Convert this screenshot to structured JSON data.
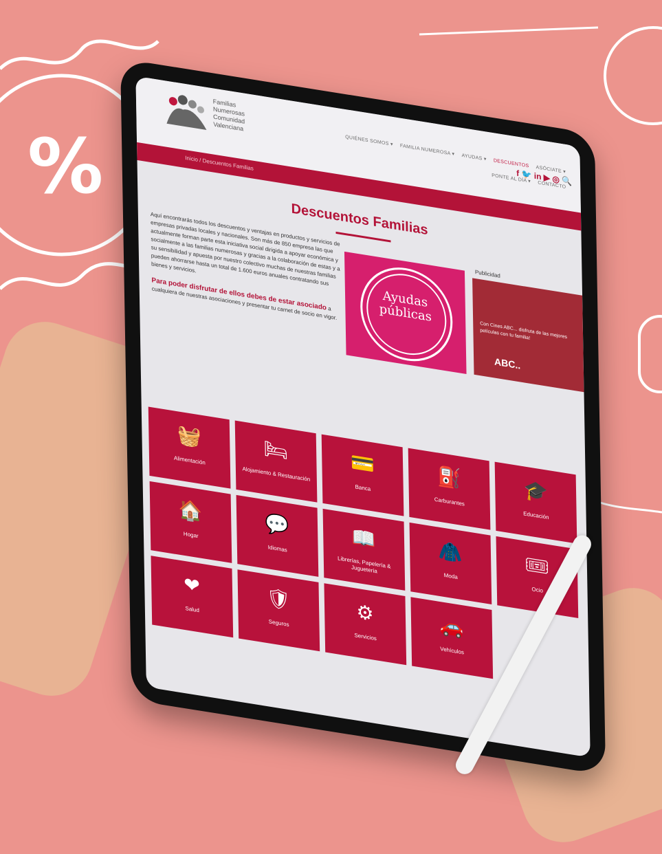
{
  "site": {
    "logo_text": "Familias Numerosas Comunidad Valenciana",
    "nav": [
      "QUIÉNES SOMOS ▾",
      "FAMILIA NUMEROSA ▾",
      "AYUDAS ▾",
      "DESCUENTOS",
      "ASÓCIATE ▾",
      "PONTE AL DÍA ▾",
      "CONTACTO"
    ],
    "breadcrumb": "Inicio / Descuentos Familias",
    "page_title": "Descuentos Familias",
    "intro": "Aquí encontrarás todos los descuentos y ventajas en productos y servicios de empresas privadas locales y nacionales. Son más de 850 empresa las que actualmente forman parte esta iniciativa social dirigida a apoyar económica y socialmente a las familias numerosas y gracias a la colaboración de estas y a su sensibilidad y apuesta por nuestro colectivo muchas de nuestras familias pueden ahorrarse hasta un total de 1.600 euros anuales contratando sus bienes y servicios.",
    "highlight": "Para poder disfrutar de ellos debes de estar asociado",
    "highlight_rest": " a cualquiera de nuestras asociaciones y presentar tu carnet de socio en vigor.",
    "promo_line1": "Ayudas",
    "promo_line2": "públicas",
    "pub_label": "Publicidad",
    "pub_text": "Con Cines ABC... disfruta de las mejores películas con tu familia!",
    "pub_brand": "ABC..",
    "colors": {
      "accent": "#b31338",
      "background": "#ec948d"
    }
  },
  "categories": [
    {
      "label": "Alimentación",
      "icon": "basket-icon",
      "glyph": "🧺"
    },
    {
      "label": "Alojamiento & Restauración",
      "icon": "bed-icon",
      "glyph": "🛏"
    },
    {
      "label": "Banca",
      "icon": "card-icon",
      "glyph": "💳"
    },
    {
      "label": "Carburantes",
      "icon": "fuel-icon",
      "glyph": "⛽"
    },
    {
      "label": "Educación",
      "icon": "graduation-cap-icon",
      "glyph": "🎓"
    },
    {
      "label": "Hogar",
      "icon": "house-icon",
      "glyph": "🏠"
    },
    {
      "label": "Idiomas",
      "icon": "translate-icon",
      "glyph": "💬"
    },
    {
      "label": "Librerías, Papelería & Juguetería",
      "icon": "book-icon",
      "glyph": "📖"
    },
    {
      "label": "Moda",
      "icon": "jacket-icon",
      "glyph": "🧥"
    },
    {
      "label": "Ocio",
      "icon": "ticket-icon",
      "glyph": "🎟"
    },
    {
      "label": "Salud",
      "icon": "heartbeat-icon",
      "glyph": "❤"
    },
    {
      "label": "Seguros",
      "icon": "shield-icon",
      "glyph": "🛡"
    },
    {
      "label": "Servicios",
      "icon": "service-gear-icon",
      "glyph": "⚙"
    },
    {
      "label": "Vehículos",
      "icon": "car-icon",
      "glyph": "🚗"
    }
  ]
}
